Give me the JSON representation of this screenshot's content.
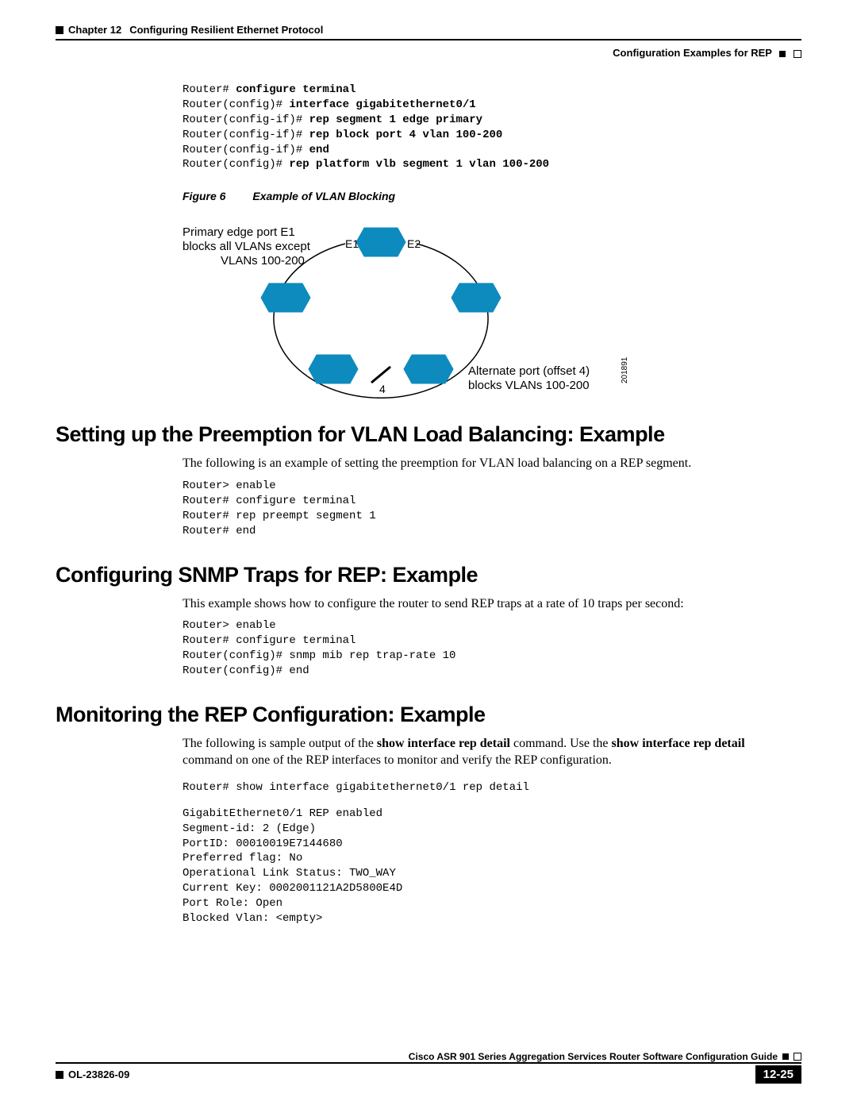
{
  "header": {
    "chapter_label": "Chapter 12",
    "chapter_title": "Configuring Resilient Ethernet Protocol",
    "section_right": "Configuration Examples for REP"
  },
  "code_block_1": {
    "l1p": "Router# ",
    "l1b": "configure terminal",
    "l2p": "Router(config)# ",
    "l2b": "interface gigabitethernet0/1",
    "l3p": "Router(config-if)# ",
    "l3b": "rep segment 1 edge primary",
    "l4p": "Router(config-if)# ",
    "l4b": "rep block port 4 vlan 100-200",
    "l5p": "Router(config-if)# ",
    "l5b": "end",
    "l6p": "Router(config)# ",
    "l6b": "rep platform vlb segment 1 vlan 100-200"
  },
  "figure": {
    "label": "Figure 6",
    "title": "Example of VLAN Blocking",
    "left_note_l1": "Primary edge port E1",
    "left_note_l2": "blocks all VLANs except",
    "left_note_l3": "VLANs 100-200",
    "e1": "E1",
    "e2": "E2",
    "bottom_num": "4",
    "right_note_l1": "Alternate port (offset 4)",
    "right_note_l2": "blocks VLANs 100-200",
    "side_id": "201891"
  },
  "s1": {
    "heading": "Setting up the Preemption for VLAN Load Balancing: Example",
    "para": "The following is an example of setting the preemption for VLAN load balancing on a REP segment.",
    "c1p": "Router> ",
    "c1b": "enable",
    "c2p": "Router# ",
    "c2b": "configure terminal",
    "c3p": "Router# ",
    "c3b": "rep preempt segment 1",
    "c4p": "Router# ",
    "c4b": "end"
  },
  "s2": {
    "heading": "Configuring SNMP Traps for REP: Example",
    "para": "This example shows how to configure the router to send REP traps at a rate of 10 traps per second:",
    "c1p": "Router> ",
    "c1b": "enable",
    "c2p": "Router# ",
    "c2b": "configure terminal",
    "c3p": "Router(config)# ",
    "c3b": "snmp mib rep trap-rate 10",
    "c4p": "Router(config)# ",
    "c4b": "end"
  },
  "s3": {
    "heading": "Monitoring the REP Configuration: Example",
    "para_pre": "The following is sample output of the ",
    "cmd1": "show interface rep detail",
    "para_mid": " command. Use the ",
    "cmd2": "show interface rep detail",
    "para_post": " command on one of the REP interfaces to monitor and verify the REP configuration.",
    "c1p": "Router# ",
    "c1b": "show interface gigabitethernet0/1 rep detail",
    "out": "GigabitEthernet0/1 REP enabled\nSegment-id: 2 (Edge)\nPortID: 00010019E7144680\nPreferred flag: No\nOperational Link Status: TWO_WAY\nCurrent Key: 0002001121A2D5800E4D\nPort Role: Open\nBlocked Vlan: <empty>"
  },
  "footer": {
    "book_title": "Cisco ASR 901 Series Aggregation Services Router Software Configuration Guide",
    "doc_id": "OL-23826-09",
    "page_num": "12-25"
  }
}
